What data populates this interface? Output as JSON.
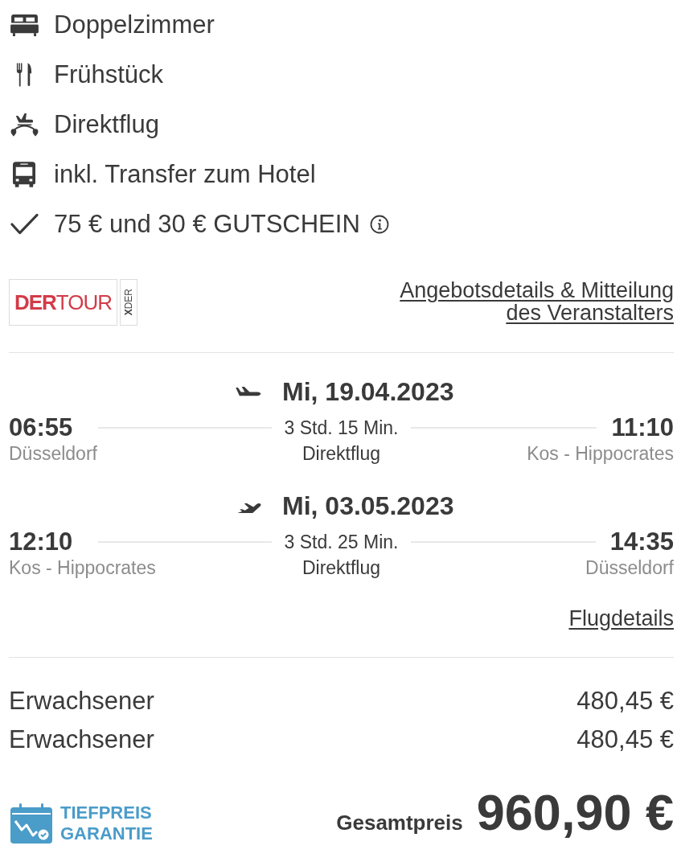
{
  "features": [
    {
      "kind": "bed",
      "text": "Doppelzimmer",
      "info": false
    },
    {
      "kind": "meal",
      "text": "Frühstück",
      "info": false
    },
    {
      "kind": "flight",
      "text": "Direktflug",
      "info": false
    },
    {
      "kind": "bus",
      "text": "inkl. Transfer zum Hotel",
      "info": false
    },
    {
      "kind": "check",
      "text": "75 € und 30 € GUTSCHEIN",
      "info": true
    }
  ],
  "operator": {
    "logo": "**DER**TOUR",
    "logo_tag": "**X**DER",
    "details_link": "Angebotsdetails & Mitteilung des Veranstalters"
  },
  "flights": [
    {
      "kind": "outbound",
      "date": "Mi, 19.04.2023",
      "depart_time": "06:55",
      "depart_city": "Düsseldorf",
      "duration": "3 Std. 15 Min.",
      "type": "Direktflug",
      "arrive_time": "11:10",
      "arrive_city": "Kos - Hippocrates"
    },
    {
      "kind": "return",
      "date": "Mi, 03.05.2023",
      "depart_time": "12:10",
      "depart_city": "Kos - Hippocrates",
      "duration": "3 Std. 25 Min.",
      "type": "Direktflug",
      "arrive_time": "14:35",
      "arrive_city": "Düsseldorf"
    }
  ],
  "flight_details_link": "Flugdetails",
  "travellers": [
    {
      "label": "Erwachsener",
      "price": "480,45 €"
    },
    {
      "label": "Erwachsener",
      "price": "480,45 €"
    }
  ],
  "guarantee": {
    "label": "TIEFPREIS GARANTIE"
  },
  "total": {
    "label": "Gesamtpreis",
    "price": "960,90 €"
  }
}
